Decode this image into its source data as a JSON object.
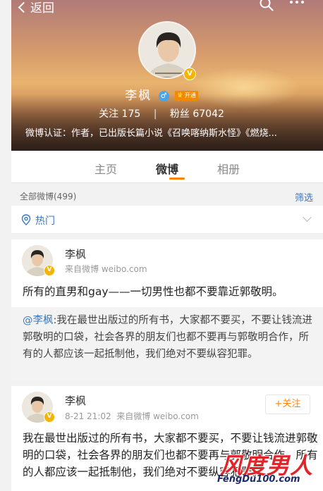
{
  "topbar": {
    "back_label": "返回"
  },
  "profile": {
    "name": "李枫",
    "member_label": "开通",
    "following_label": "关注",
    "following_count": "175",
    "fans_label": "粉丝",
    "fans_count": "67042",
    "verification": "微博认证：作者，已出版长篇小说《召唤喀纳斯水怪》《燃烧..."
  },
  "tabs": [
    {
      "label": "主页"
    },
    {
      "label": "微博"
    },
    {
      "label": "相册"
    }
  ],
  "feed": {
    "all_label": "全部微博(499)",
    "filter_label": "筛选",
    "hot_label": "热门"
  },
  "post1": {
    "author": "李枫",
    "source": "来自微博 weibo.com",
    "text": "所有的直男和gay——一切男性也都不要靠近郭敬明。"
  },
  "repost": {
    "mention": "@李枫",
    "text": ":我在最世出版过的所有书，大家都不要买，不要让钱流进郭敬明的口袋，社会各界的朋友们也都不要再与郭敬明合作，所有的人都应该一起抵制他，我们绝对不要纵容犯罪。"
  },
  "post2": {
    "author": "李枫",
    "time": "8-21 21:02",
    "source": "来自微博 weibo.com",
    "follow_label": "+关注",
    "text": "我在最世出版过的所有书，大家都不要买，不要让钱流进郭敬明的口袋，社会各界的朋友们也都不要再与郭敬明合作，所有的人都应该一起抵制他，我们绝对不要纵容犯罪。"
  },
  "watermark": {
    "title": "风度男人",
    "url": "FengDu100.com"
  },
  "colors": {
    "accent_orange": "#ff8200",
    "link_blue": "#3a78c3",
    "vip_gold": "#f5b400"
  }
}
